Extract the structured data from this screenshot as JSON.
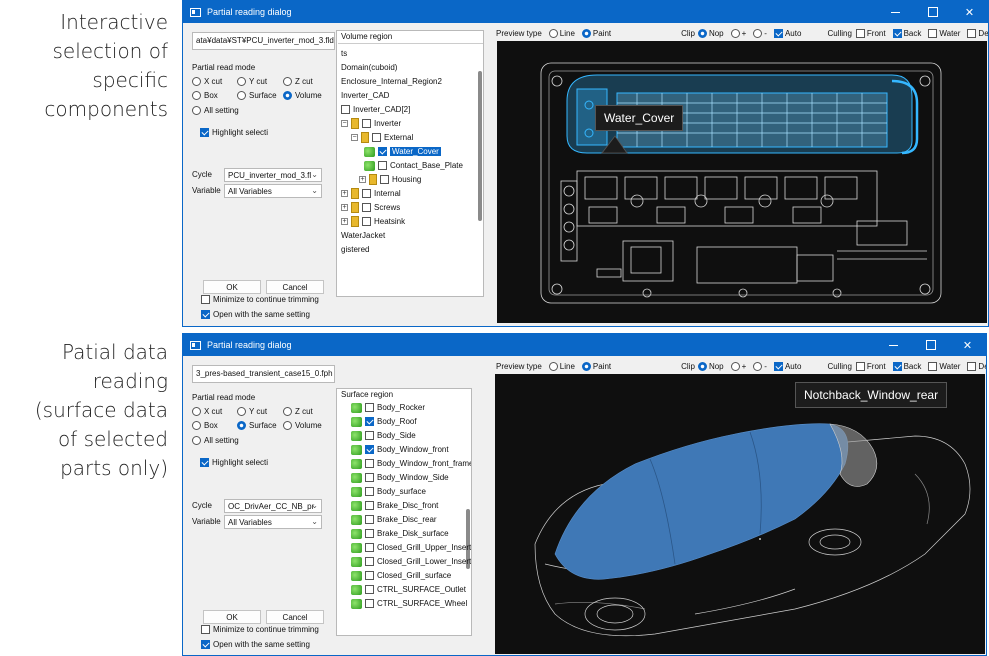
{
  "captions": {
    "top": [
      "Interactive",
      "selection of",
      "specific",
      "components"
    ],
    "bottom": [
      "Patial data",
      "reading",
      "(surface data",
      "of selected",
      "parts only)"
    ]
  },
  "dialogs": [
    {
      "title": "Partial reading dialog",
      "path": "ata¥data¥ST¥PCU_inverter_mod_3.fld",
      "partial_read_mode_label": "Partial read mode",
      "modes": [
        "X cut",
        "Y cut",
        "Z cut",
        "Box",
        "Surface",
        "Volume",
        "All setting"
      ],
      "selected_mode": "Volume",
      "highlight_label": "Highlight selecti",
      "highlight_checked": true,
      "cycle_label": "Cycle",
      "cycle_value": "PCU_inverter_mod_3.fl",
      "variable_label": "Variable",
      "variable_value": "All Variables",
      "ok_label": "OK",
      "cancel_label": "Cancel",
      "minimize_label": "Minimize to continue trimming",
      "minimize_checked": false,
      "open_same_label": "Open with the same setting",
      "open_same_checked": true,
      "tree_title": "Volume region",
      "tree": [
        {
          "label": "ts",
          "indent": 0,
          "kind": "text"
        },
        {
          "label": "Domain(cuboid)",
          "indent": 0,
          "kind": "text"
        },
        {
          "label": "Enclosure_Internal_Region2",
          "indent": 0,
          "kind": "text"
        },
        {
          "label": "Inverter_CAD",
          "indent": 0,
          "kind": "text"
        },
        {
          "label": "Inverter_CAD[2]",
          "indent": 0,
          "kind": "check",
          "checked": false
        },
        {
          "label": "Inverter",
          "indent": 1,
          "kind": "folder",
          "checked": false
        },
        {
          "label": "External",
          "indent": 2,
          "kind": "folder",
          "checked": false
        },
        {
          "label": "Water_Cover",
          "indent": 3,
          "kind": "solid",
          "checked": true,
          "selected": true
        },
        {
          "label": "Contact_Base_Plate",
          "indent": 3,
          "kind": "solid",
          "checked": false
        },
        {
          "label": "Housing",
          "indent": 3,
          "kind": "folder",
          "checked": false
        },
        {
          "label": "Internal",
          "indent": 1,
          "kind": "folder",
          "checked": false
        },
        {
          "label": "Screws",
          "indent": 1,
          "kind": "folder",
          "checked": false
        },
        {
          "label": "Heatsink",
          "indent": 1,
          "kind": "folder",
          "checked": false
        },
        {
          "label": "WaterJacket",
          "indent": 0,
          "kind": "text"
        },
        {
          "label": "gistered",
          "indent": 0,
          "kind": "text"
        }
      ],
      "toolbar": {
        "preview_type": "Preview type",
        "line": "Line",
        "paint": "Paint",
        "clip": "Clip",
        "nop": "Nop",
        "plus": "+",
        "minus": "-",
        "auto": "Auto",
        "culling": "Culling",
        "front": "Front",
        "back": "Back",
        "water": "Water",
        "depth": "Depth"
      },
      "view_tag": "Water_Cover"
    },
    {
      "title": "Partial reading dialog",
      "path": "3_pres-based_transient_case15_0.fph",
      "partial_read_mode_label": "Partial read mode",
      "modes": [
        "X cut",
        "Y cut",
        "Z cut",
        "Box",
        "Surface",
        "Volume",
        "All setting"
      ],
      "selected_mode": "Surface",
      "highlight_label": "Highlight selecti",
      "highlight_checked": true,
      "cycle_label": "Cycle",
      "cycle_value": "OC_DrivAer_CC_NB_pr",
      "variable_label": "Variable",
      "variable_value": "All Variables",
      "ok_label": "OK",
      "cancel_label": "Cancel",
      "minimize_label": "Minimize to continue trimming",
      "minimize_checked": false,
      "open_same_label": "Open with the same setting",
      "open_same_checked": true,
      "tree_title": "Surface region",
      "tree": [
        {
          "label": "Body_Rocker",
          "checked": false
        },
        {
          "label": "Body_Roof",
          "checked": true
        },
        {
          "label": "Body_Side",
          "checked": false
        },
        {
          "label": "Body_Window_front",
          "checked": true
        },
        {
          "label": "Body_Window_front_frame",
          "checked": false
        },
        {
          "label": "Body_Window_Side",
          "checked": false
        },
        {
          "label": "Body_surface",
          "checked": false
        },
        {
          "label": "Brake_Disc_front",
          "checked": false
        },
        {
          "label": "Brake_Disc_rear",
          "checked": false
        },
        {
          "label": "Brake_Disk_surface",
          "checked": false
        },
        {
          "label": "Closed_Grill_Upper_Insert",
          "checked": false
        },
        {
          "label": "Closed_Grill_Lower_Insert",
          "checked": false
        },
        {
          "label": "Closed_Grill_surface",
          "checked": false
        },
        {
          "label": "CTRL_SURFACE_Outlet",
          "checked": false
        },
        {
          "label": "CTRL_SURFACE_Wheel",
          "checked": false
        }
      ],
      "toolbar": {
        "preview_type": "Preview type",
        "line": "Line",
        "paint": "Paint",
        "clip": "Clip",
        "nop": "Nop",
        "plus": "+",
        "minus": "-",
        "auto": "Auto",
        "culling": "Culling",
        "front": "Front",
        "back": "Back",
        "water": "Water",
        "depth": "Depth"
      },
      "view_tag": "Notchback_Window_rear"
    }
  ],
  "colors": {
    "titlebar": "#0a67c7",
    "highlight_cyan": "#35b7ff",
    "car_blue": "#3f78b6"
  }
}
